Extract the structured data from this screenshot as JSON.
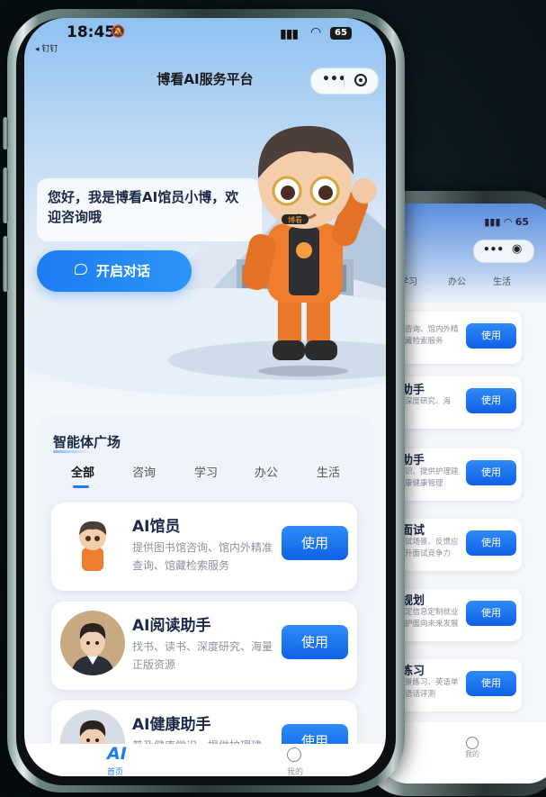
{
  "status_bar": {
    "time": "18:45",
    "back_app": "◂ 钉钉",
    "battery": "65"
  },
  "header": {
    "title": "博看AI服务平台",
    "more_icon": "more-dots-icon",
    "close_icon": "target-circle-icon"
  },
  "hero": {
    "greeting": "您好，我是博看AI馆员小博，欢迎咨询哦",
    "start_button": "开启对话",
    "mascot_badge": "博看"
  },
  "agents": {
    "section_title": "智能体广场",
    "tabs": [
      "全部",
      "咨询",
      "学习",
      "办公",
      "生活"
    ],
    "active_tab": "全部",
    "use_label": "使用",
    "cards": [
      {
        "title": "AI馆员",
        "desc": "提供图书馆咨询、馆内外精准查询、馆藏检索服务"
      },
      {
        "title": "AI阅读助手",
        "desc": "找书、读书、深度研究、海量正版资源"
      },
      {
        "title": "AI健康助手",
        "desc": "普及健康常识、提供护理建"
      }
    ]
  },
  "tabbar": {
    "home_icon": "AI",
    "home_label": "首页",
    "me_label": "我的"
  },
  "back_phone": {
    "tabs": [
      "学习",
      "办公",
      "生活"
    ],
    "use_label": "使用",
    "me_label": "我的",
    "cards": [
      {
        "title": "",
        "desc": "咨询、馆内外精\n藏检索服务"
      },
      {
        "title": "助手",
        "desc": "深度研究、海"
      },
      {
        "title": "助手",
        "desc": "识、提供护理建\n康健康管理"
      },
      {
        "title": "面试",
        "desc": "试场景、反馈应\n升面试竞争力"
      },
      {
        "title": "规划",
        "desc": "定信息定制就业\n护面向未来发展"
      },
      {
        "title": "练习",
        "desc": "景练习、英语单\n语话评测"
      }
    ]
  },
  "colors": {
    "accent": "#1d7cf2",
    "title_text": "#1c2a4a",
    "desc_text": "#8a93a3",
    "bg_dark": "#0a1418"
  }
}
